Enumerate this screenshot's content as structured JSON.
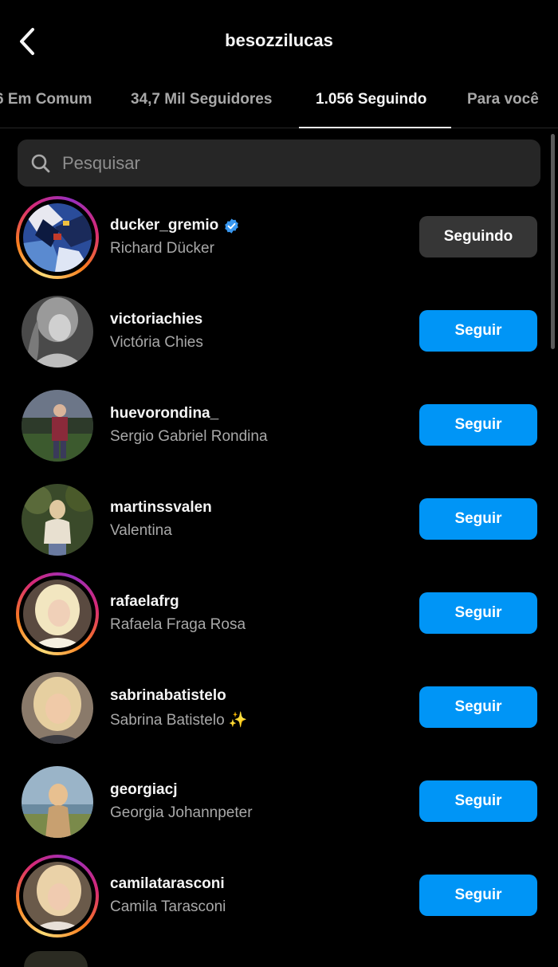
{
  "header": {
    "title": "besozzilucas",
    "back_icon": "chevron-left-icon"
  },
  "tabs": [
    {
      "label": "6 Em Comum",
      "active": false
    },
    {
      "label": "34,7 Mil Seguidores",
      "active": false
    },
    {
      "label": "1.056 Seguindo",
      "active": true
    },
    {
      "label": "Para você",
      "active": false
    }
  ],
  "search": {
    "placeholder": "Pesquisar",
    "icon": "search-icon"
  },
  "colors": {
    "background": "#000000",
    "follow_button": "#0095f6",
    "following_button": "#363636",
    "secondary_text": "#a8a8a8",
    "verified": "#3897f0"
  },
  "users": [
    {
      "username": "ducker_gremio",
      "full_name": "Richard Dücker",
      "verified": true,
      "story": true,
      "button": "Seguindo"
    },
    {
      "username": "victoriachies",
      "full_name": "Victória Chies",
      "verified": false,
      "story": false,
      "button": "Seguir"
    },
    {
      "username": "huevorondina_",
      "full_name": "Sergio Gabriel Rondina",
      "verified": false,
      "story": false,
      "button": "Seguir"
    },
    {
      "username": "martinssvalen",
      "full_name": "Valentina",
      "verified": false,
      "story": false,
      "button": "Seguir"
    },
    {
      "username": "rafaelafrg",
      "full_name": "Rafaela Fraga Rosa",
      "verified": false,
      "story": true,
      "button": "Seguir"
    },
    {
      "username": "sabrinabatistelo",
      "full_name": "Sabrina Batistelo ✨",
      "verified": false,
      "story": false,
      "button": "Seguir"
    },
    {
      "username": "georgiacj",
      "full_name": "Georgia Johannpeter",
      "verified": false,
      "story": false,
      "button": "Seguir"
    },
    {
      "username": "camilatarasconi",
      "full_name": "Camila Tarasconi",
      "verified": false,
      "story": true,
      "button": "Seguir"
    }
  ]
}
